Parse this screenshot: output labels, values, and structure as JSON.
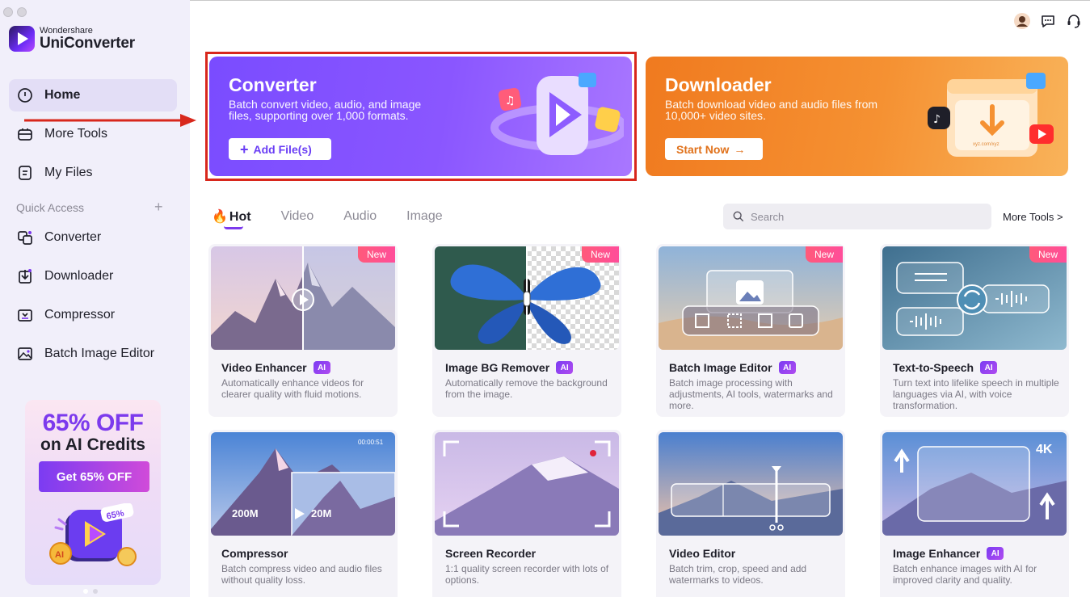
{
  "app": {
    "brand_small": "Wondershare",
    "brand_name": "UniConverter"
  },
  "sidebar": {
    "nav": [
      {
        "label": "Home",
        "icon": "home-icon",
        "active": true
      },
      {
        "label": "More Tools",
        "icon": "toolbox-icon"
      },
      {
        "label": "My Files",
        "icon": "file-icon"
      }
    ],
    "quick_access_label": "Quick Access",
    "quick_access": [
      {
        "label": "Converter",
        "icon": "converter-icon"
      },
      {
        "label": "Downloader",
        "icon": "downloader-icon"
      },
      {
        "label": "Compressor",
        "icon": "compressor-icon"
      },
      {
        "label": "Batch Image Editor",
        "icon": "image-editor-icon"
      }
    ],
    "promo": {
      "title": "65% OFF",
      "subtitle": "on AI Credits",
      "button": "Get 65% OFF",
      "art_tag": "65%",
      "art_badge": "AI"
    }
  },
  "banners": {
    "converter": {
      "title": "Converter",
      "description": "Batch convert video, audio, and image files, supporting over 1,000 formats.",
      "button": "Add File(s)"
    },
    "downloader": {
      "title": "Downloader",
      "description": "Batch download video and audio files from 10,000+ video sites.",
      "button": "Start Now",
      "url_text": "xyz.com/xyz"
    }
  },
  "tabs": {
    "items": [
      "Hot",
      "Video",
      "Audio",
      "Image"
    ],
    "active": "Hot"
  },
  "search": {
    "placeholder": "Search"
  },
  "more_tools_link": "More Tools >",
  "cards": [
    {
      "title": "Video Enhancer",
      "ai": "AI",
      "new": "New",
      "desc": "Automatically enhance videos for clearer quality with fluid motions."
    },
    {
      "title": "Image BG Remover",
      "ai": "AI",
      "new": "New",
      "desc": "Automatically remove the background from the image."
    },
    {
      "title": "Batch Image Editor",
      "ai": "AI",
      "new": "New",
      "desc": "Batch image processing with adjustments, AI tools, watermarks and more."
    },
    {
      "title": "Text-to-Speech",
      "ai": "AI",
      "new": "New",
      "desc": "Turn text into lifelike speech in multiple languages via AI, with voice transformation."
    },
    {
      "title": "Compressor",
      "desc": "Batch compress video and audio files without quality loss.",
      "thumb_time": "00:00:51",
      "thumb_from": "200M",
      "thumb_to": "20M"
    },
    {
      "title": "Screen Recorder",
      "desc": "1:1 quality screen recorder with lots of options."
    },
    {
      "title": "Video Editor",
      "desc": "Batch trim, crop, speed and add watermarks to videos."
    },
    {
      "title": "Image Enhancer",
      "ai": "AI",
      "desc": "Batch enhance images with AI for improved clarity and quality.",
      "thumb_label": "4K"
    }
  ],
  "colors": {
    "accent": "#7c3aed",
    "converter_banner": "#7a4cff",
    "downloader_banner": "#f07a1f",
    "highlight_box": "#d8271c",
    "annotation_arrow": "#d8271c"
  }
}
